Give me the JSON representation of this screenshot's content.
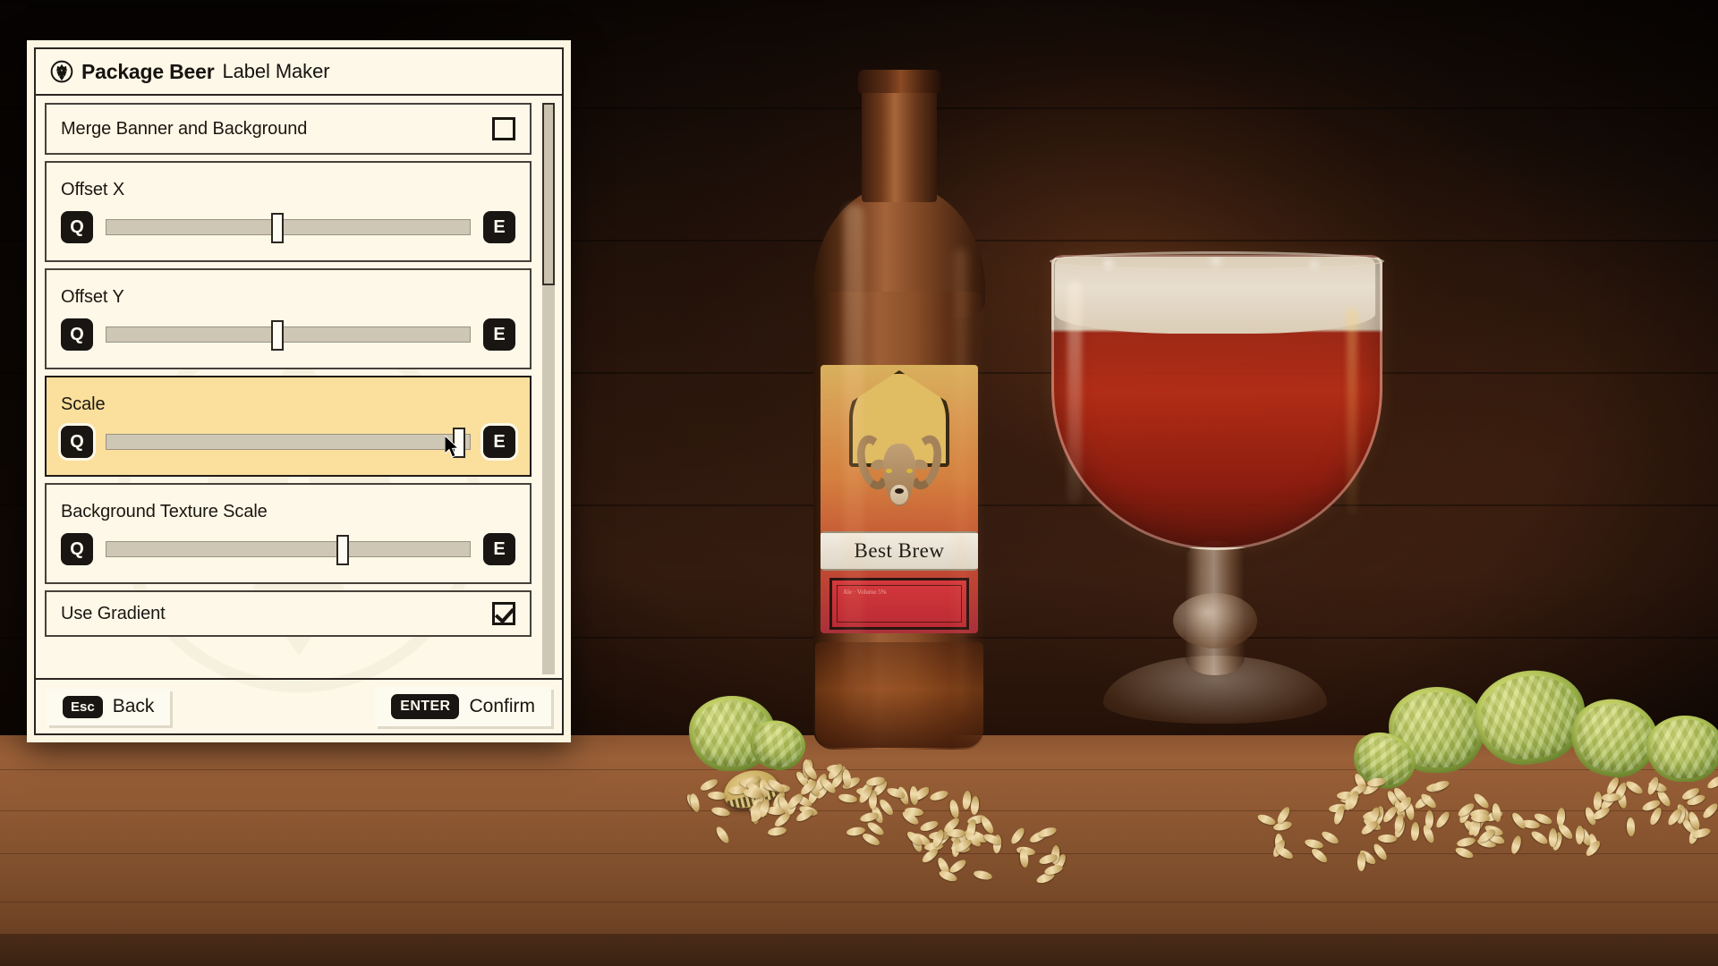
{
  "window": {
    "title_bold": "Package Beer",
    "title_regular": "Label Maker",
    "logo_icon": "hop-cone-circle-icon"
  },
  "settings": {
    "rows": [
      {
        "id": "merge-banner-and-background",
        "label": "Merge Banner and Background",
        "type": "checkbox",
        "checked": false,
        "selected": false
      },
      {
        "id": "offset-x",
        "label": "Offset X",
        "type": "slider",
        "value_percent": 47,
        "decrease_key": "Q",
        "increase_key": "E",
        "selected": false
      },
      {
        "id": "offset-y",
        "label": "Offset Y",
        "type": "slider",
        "value_percent": 47,
        "decrease_key": "Q",
        "increase_key": "E",
        "selected": false
      },
      {
        "id": "scale",
        "label": "Scale",
        "type": "slider",
        "value_percent": 97,
        "decrease_key": "Q",
        "increase_key": "E",
        "selected": true
      },
      {
        "id": "background-texture-scale",
        "label": "Background Texture Scale",
        "type": "slider",
        "value_percent": 65,
        "decrease_key": "Q",
        "increase_key": "E",
        "selected": false
      },
      {
        "id": "use-gradient",
        "label": "Use Gradient",
        "type": "checkbox",
        "checked": true,
        "selected": false
      }
    ],
    "scrollbar": {
      "thumb_top_percent": 0,
      "thumb_height_percent": 32
    }
  },
  "footer": {
    "back": {
      "key": "Esc",
      "label": "Back"
    },
    "confirm": {
      "key": "ENTER",
      "label": "Confirm"
    }
  },
  "scene": {
    "bottle_label": {
      "banner_text": "Best Brew",
      "lower_text": "Ale · Volume 5%",
      "illustration": "ram-head-icon"
    },
    "colors": {
      "panel_bg": "#fdf8e8",
      "panel_frame": "#2a2520",
      "selected_row": "#fbdf9d",
      "key_badge": "#191512",
      "track": "#cfc7b5",
      "table_wood": "#8d5832",
      "beer_liquid": "#ba2e16",
      "foam": "#e8dece",
      "hop_green": "#b9c95c"
    }
  }
}
